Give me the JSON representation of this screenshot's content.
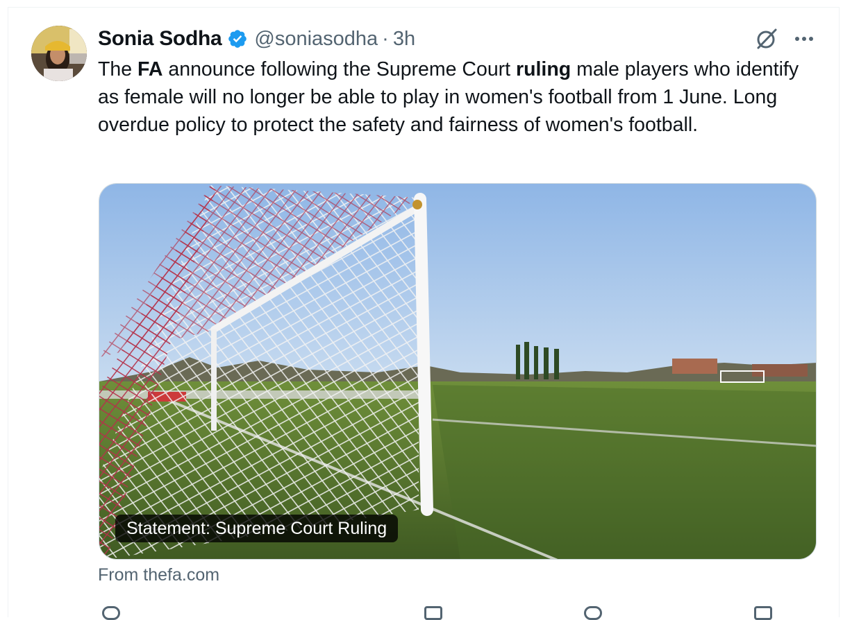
{
  "author": {
    "name": "Sonia Sodha",
    "handle": "@soniasodha",
    "separator": "·",
    "time": "3h",
    "verified_icon": "verified-badge-icon"
  },
  "post": {
    "text_parts": [
      {
        "text": "The ",
        "bold": false
      },
      {
        "text": "FA",
        "bold": true
      },
      {
        "text": " announce following the Supreme Court ",
        "bold": false
      },
      {
        "text": "ruling",
        "bold": true
      },
      {
        "text": " male players who identify as female will no longer be able to play in women's football from 1 June. Long overdue policy to protect the safety and fairness of women's football.",
        "bold": false
      }
    ]
  },
  "card": {
    "caption": "Statement: Supreme Court Ruling",
    "source": "From thefa.com",
    "image_icon": "football-goal-photo"
  },
  "icons": {
    "grok": "grok-icon",
    "more": "more-options-icon"
  },
  "colors": {
    "verified": "#1d9bf0",
    "secondary_text": "#536471",
    "sky": "#a9c9ef",
    "pitch": "#5d7f2e"
  }
}
